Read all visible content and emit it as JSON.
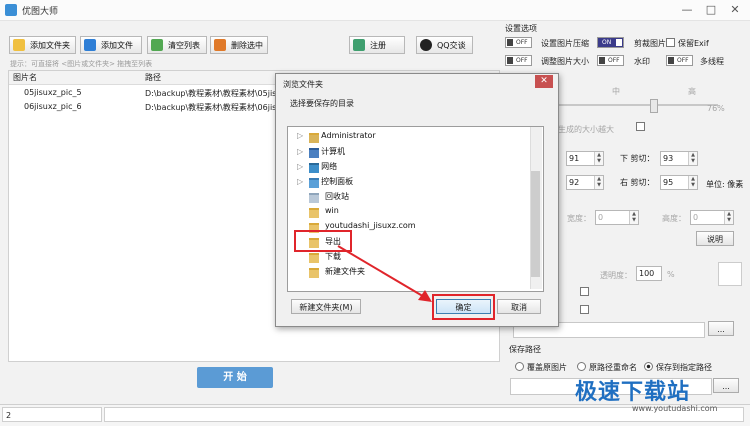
{
  "window": {
    "title": "优图大师",
    "minimize": "—",
    "maximize": "□",
    "close": "✕"
  },
  "toolbar": {
    "add_folder": "添加文件夹",
    "add_file": "添加文件",
    "clear_list": "清空列表",
    "delete_selected": "删除选中",
    "register": "注册",
    "qq": "QQ交谈"
  },
  "hint": "提示：可直接将 <图片或文件夹> 拖拽至列表",
  "table": {
    "headers": [
      "图片名",
      "路径"
    ],
    "rows": [
      {
        "name": "05jisuxz_pic_5",
        "path": "D:\\backup\\教程素材\\教程素材\\05jisu"
      },
      {
        "name": "06jisuxz_pic_6",
        "path": "D:\\backup\\教程素材\\教程素材\\06jisu"
      }
    ]
  },
  "start_button": "开 始",
  "status": {
    "count": "2"
  },
  "settings": {
    "heading": "设置选项",
    "compress_label": "设置图片压缩",
    "compress_toggle": "OFF",
    "crop_label": "剪裁图片",
    "crop_toggle": "ON",
    "exif_label": "保留Exif",
    "resize_label": "调整图片大小",
    "resize_toggle": "OFF",
    "watermark_label": "水印",
    "watermark_toggle": "OFF",
    "multithread_label": "多线程",
    "multithread_toggle": "OFF",
    "quality_mid": "中",
    "quality_high": "高",
    "quality_percent": "76%",
    "quality_note": "生成的大小越大",
    "crop": {
      "left_value": "91",
      "top_label": "下 剪切：",
      "top_value": "93",
      "bottom_value": "92",
      "right_label": "右 剪切：",
      "right_value": "95",
      "unit": "单位: 像素"
    },
    "width_label": "宽度：",
    "width_value": "0",
    "height_label": "高度：",
    "height_value": "0",
    "explain_button": "说明",
    "opacity_label": "透明度：",
    "opacity_value": "100",
    "opacity_unit": "%",
    "browse_button": "..."
  },
  "save_path": {
    "heading": "保存路径",
    "opt_overwrite": "覆盖原图片",
    "opt_rename": "原路径重命名",
    "opt_custom": "保存到指定路径",
    "browse": "..."
  },
  "dialog": {
    "title": "浏览文件夹",
    "close": "✕",
    "prompt": "选择要保存的目录",
    "tree": [
      "Administrator",
      "计算机",
      "网络",
      "控制面板",
      "回收站",
      "win",
      "youtudashi_jisuxz.com",
      "导出",
      "下载",
      "新建文件夹"
    ],
    "new_folder": "新建文件夹(M)",
    "ok": "确定",
    "cancel": "取消"
  },
  "watermark": {
    "brand": "极速下载站",
    "url": "www.youtudashi.com"
  }
}
